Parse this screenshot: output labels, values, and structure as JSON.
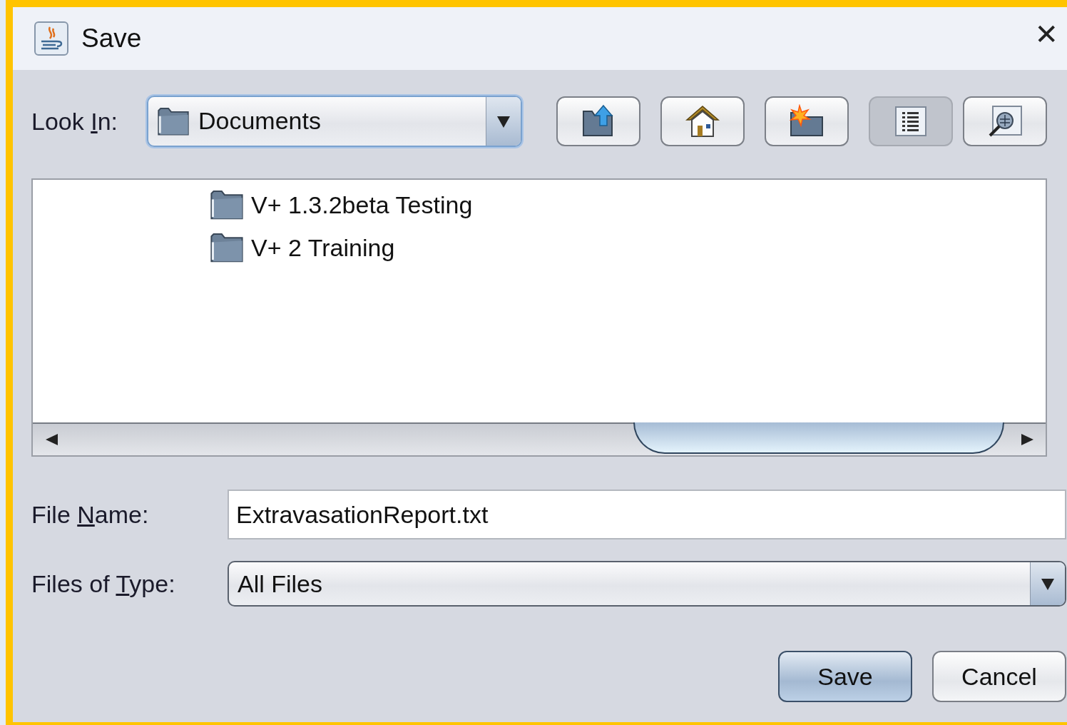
{
  "window": {
    "title": "Save",
    "close": "✕"
  },
  "look_in": {
    "label": [
      "Look ",
      "I",
      "n:"
    ],
    "value": "Documents"
  },
  "toolbar": [
    {
      "kind": "up",
      "selected": false
    },
    {
      "kind": "home",
      "selected": false
    },
    {
      "kind": "new-folder",
      "selected": false
    },
    {
      "kind": "list",
      "selected": true
    },
    {
      "kind": "details",
      "selected": false
    }
  ],
  "files": [
    {
      "name": "V+ 1.3.2beta Testing"
    },
    {
      "name": "V+ 2 Training"
    }
  ],
  "file_name": {
    "label": [
      "File ",
      "N",
      "ame:"
    ],
    "value": "ExtravasationReport.txt"
  },
  "file_type": {
    "label": [
      "Files of ",
      "T",
      "ype:"
    ],
    "value": "All Files"
  },
  "buttons": [
    {
      "label": "Save",
      "kind": "default"
    },
    {
      "label": "Cancel",
      "kind": "normal"
    }
  ]
}
